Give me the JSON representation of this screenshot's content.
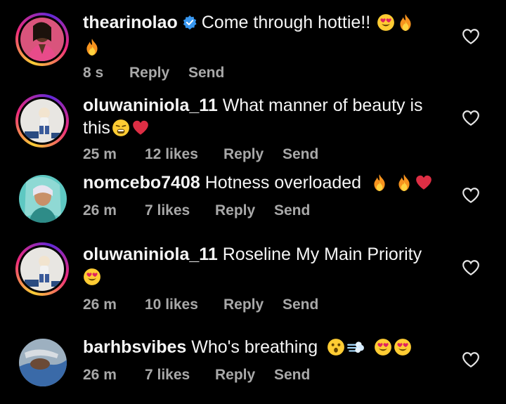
{
  "comments": [
    {
      "username": "thearinolao",
      "verified": true,
      "text": "Come through hottie!!",
      "time": "8 s",
      "likes": "",
      "reply": "Reply",
      "send": "Send"
    },
    {
      "username": "oluwaniniola_11",
      "verified": false,
      "text": "What manner of beauty is this",
      "time": "25 m",
      "likes": "12 likes",
      "reply": "Reply",
      "send": "Send"
    },
    {
      "username": "nomcebo7408",
      "verified": false,
      "text": "Hotness overloaded",
      "time": "26 m",
      "likes": "7 likes",
      "reply": "Reply",
      "send": "Send"
    },
    {
      "username": "oluwaniniola_11",
      "verified": false,
      "text": "Roseline My Main Priority",
      "time": "26 m",
      "likes": "10 likes",
      "reply": "Reply",
      "send": "Send"
    },
    {
      "username": "barhbsvibes",
      "verified": false,
      "text": "Who's breathing",
      "time": "26 m",
      "likes": "7 likes",
      "reply": "Reply",
      "send": "Send"
    }
  ],
  "icons": {
    "like": "heart-outline-icon",
    "verified": "verified-badge-icon",
    "fire": "fire-emoji-icon",
    "heart_eyes": "heart-eyes-emoji-icon",
    "red_heart": "red-heart-emoji-icon",
    "weary": "weary-face-emoji-icon",
    "astonished": "astonished-face-emoji-icon",
    "dash": "dash-emoji-icon"
  },
  "colors": {
    "background": "#000000",
    "text": "#f5f5f5",
    "meta": "#a8a8a8",
    "verified": "#3897f0"
  }
}
